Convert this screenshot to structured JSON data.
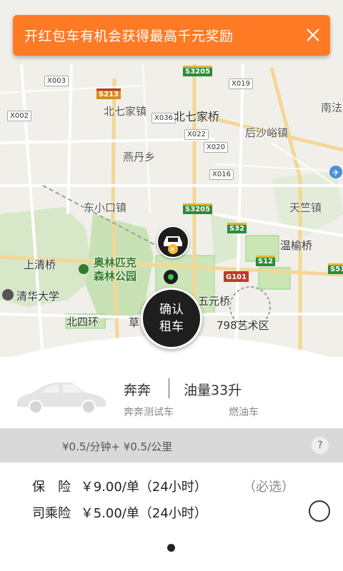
{
  "banner": {
    "text": "开红包车有机会获得最高千元奖励",
    "close_icon": "close-icon"
  },
  "map": {
    "places": [
      "北七家镇",
      "北七家桥",
      "南法",
      "后沙峪镇",
      "燕丹乡",
      "东小口镇",
      "天竺镇",
      "温榆桥",
      "上清桥",
      "奥林匹克",
      "森林公园",
      "清华大学",
      "北四环",
      "五元桥",
      "798艺术区",
      "草"
    ],
    "roads": [
      "X003",
      "X019",
      "S3205",
      "S213",
      "X002",
      "X036",
      "X022",
      "X020",
      "X016",
      "S3205",
      "S32",
      "S12",
      "S51",
      "G101"
    ]
  },
  "confirm_button": {
    "line1": "确认",
    "line2": "租车"
  },
  "car": {
    "name": "奔奔",
    "fuel": "油量33升",
    "subtitle": "奔奔测试车",
    "fuel_type": "燃油车"
  },
  "price": {
    "text": "¥0.5/分钟+ ¥0.5/公里",
    "help": "?"
  },
  "insurance": [
    {
      "label": "保　险",
      "price": "￥9.00/单（24小时）",
      "note": "（必选）"
    },
    {
      "label": "司乘险",
      "price": "￥5.00/单（24小时）",
      "note": ""
    }
  ],
  "colors": {
    "banner": "#ff7a25",
    "park": "#b9dca5",
    "button": "#1e1e1e",
    "price_bar": "#d9d9d9"
  }
}
